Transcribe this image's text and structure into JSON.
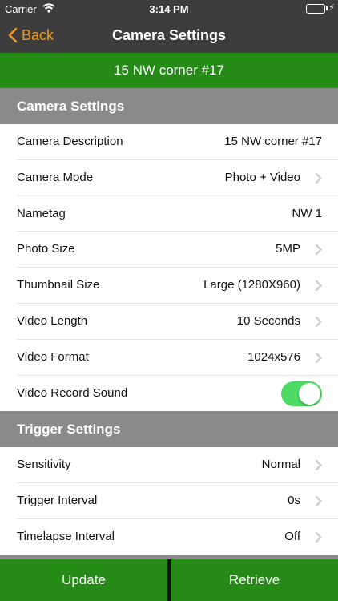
{
  "status": {
    "carrier": "Carrier",
    "time": "3:14 PM"
  },
  "nav": {
    "back_label": "Back",
    "title": "Camera Settings"
  },
  "banner": {
    "camera_name": "15 NW corner #17"
  },
  "camera_section": {
    "header": "Camera Settings",
    "rows": [
      {
        "label": "Camera Description",
        "value": "15 NW corner #17"
      },
      {
        "label": "Camera Mode",
        "value": "Photo + Video"
      },
      {
        "label": "Nametag",
        "value": "NW 1"
      },
      {
        "label": "Photo Size",
        "value": "5MP"
      },
      {
        "label": "Thumbnail Size",
        "value": "Large (1280X960)"
      },
      {
        "label": "Video Length",
        "value": "10 Seconds"
      },
      {
        "label": "Video Format",
        "value": "1024x576"
      },
      {
        "label": "Video Record Sound",
        "toggle_on": true
      }
    ]
  },
  "trigger_section": {
    "header": "Trigger Settings",
    "rows": [
      {
        "label": "Sensitivity",
        "value": "Normal"
      },
      {
        "label": "Trigger Interval",
        "value": "0s"
      },
      {
        "label": "Timelapse Interval",
        "value": "Off"
      }
    ]
  },
  "bottom": {
    "update_label": "Update",
    "retrieve_label": "Retrieve"
  },
  "colors": {
    "accent": "#f39a1e",
    "brand_green": "#268a17",
    "header_gray": "#8a8a8a",
    "bar_dark": "#3d3d3d",
    "toggle_on": "#4cd964"
  },
  "icons": {
    "wifi": "wifi-icon",
    "battery": "battery-icon",
    "charging": "charging-bolt-icon",
    "back": "chevron-left-icon",
    "disclosure": "chevron-right-icon"
  }
}
